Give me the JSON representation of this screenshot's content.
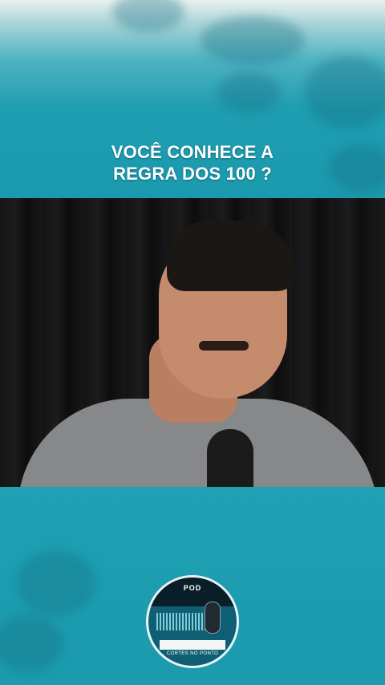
{
  "headline": {
    "line1": "VOCÊ CONHECE A",
    "line2": "REGRA DOS 100 ?"
  },
  "logo": {
    "top_text": "POD",
    "bottom_text": "CORTES NO PONTO"
  },
  "colors": {
    "background_teal": "#1f9cb0",
    "headline_text": "#ffffff",
    "video_background": "#0c0c0d"
  }
}
